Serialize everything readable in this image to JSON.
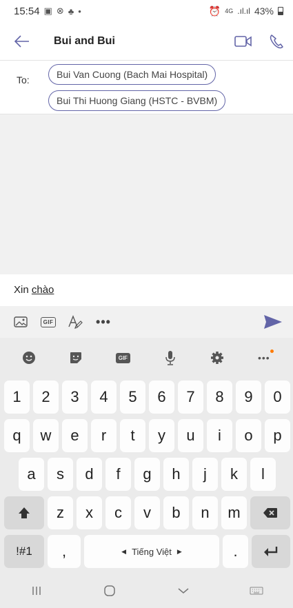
{
  "status_bar": {
    "time": "15:54",
    "network": "4G",
    "battery_percent": "43%"
  },
  "header": {
    "title": "Bui and Bui",
    "icons": [
      "back-arrow-icon",
      "video-call-icon",
      "phone-call-icon"
    ]
  },
  "recipients": {
    "to_label": "To:",
    "chips": [
      "Bui Van Cuong (Bach Mai Hospital)",
      "Bui Thi  Huong Giang (HSTC - BVBM)"
    ]
  },
  "compose": {
    "prefix": "Xin ",
    "typed": "chào"
  },
  "compose_toolbar": {
    "gif_label": "GIF",
    "more_label": "•••"
  },
  "keyboard": {
    "toolbar_gif_label": "GIF",
    "row_numbers": [
      "1",
      "2",
      "3",
      "4",
      "5",
      "6",
      "7",
      "8",
      "9",
      "0"
    ],
    "row_top": [
      "q",
      "w",
      "e",
      "r",
      "t",
      "y",
      "u",
      "i",
      "o",
      "p"
    ],
    "row_home": [
      "a",
      "s",
      "d",
      "f",
      "g",
      "h",
      "j",
      "k",
      "l"
    ],
    "row_bottom": [
      "z",
      "x",
      "c",
      "v",
      "b",
      "n",
      "m"
    ],
    "symbols_label": "!#1",
    "comma_label": ",",
    "space_label": "Tiếng Việt",
    "period_label": ".",
    "accent_color": "#ff7a00"
  },
  "theme": {
    "accent": "#6264a7",
    "send_color": "#6264a7"
  }
}
